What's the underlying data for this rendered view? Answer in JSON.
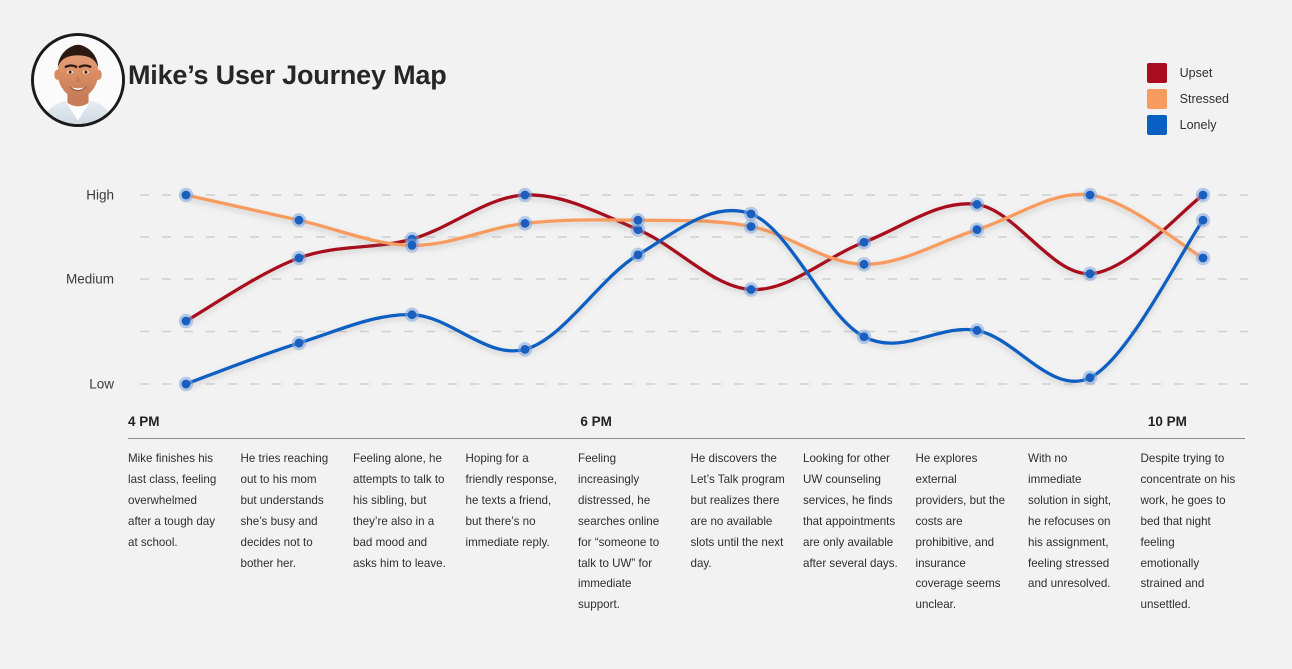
{
  "header": {
    "title": "Mike’s User Journey Map",
    "avatar_alt": "avatar"
  },
  "legend": {
    "items": [
      {
        "label": "Upset",
        "color": "#A80C1E"
      },
      {
        "label": "Stressed",
        "color": "#F89B5F"
      },
      {
        "label": "Lonely",
        "color": "#0A5FC2"
      }
    ]
  },
  "chart_data": {
    "type": "line",
    "title": "Mike’s User Journey Map",
    "xlabel": "",
    "ylabel": "",
    "grid": true,
    "legend_position": "top-right",
    "y_tick_labels": [
      "High",
      "Medium",
      "Low"
    ],
    "y_axis_levels": [
      "Low",
      "Medium",
      "High"
    ],
    "x_tick_labels": [
      "4 PM",
      "6 PM",
      "10 PM"
    ],
    "x_tick_positions": [
      0,
      4,
      9
    ],
    "x": [
      0,
      1,
      2,
      3,
      4,
      5,
      6,
      7,
      8,
      9
    ],
    "series": [
      {
        "name": "Upset",
        "color": "#A80C1E",
        "values": [
          1.0,
          2.0,
          2.3,
          3.0,
          2.45,
          1.5,
          2.25,
          2.85,
          1.75,
          3.0
        ]
      },
      {
        "name": "Stressed",
        "color": "#F89B5F",
        "values": [
          3.0,
          2.6,
          2.2,
          2.55,
          2.6,
          2.5,
          1.9,
          2.45,
          3.0,
          2.0
        ]
      },
      {
        "name": "Lonely",
        "color": "#0A5FC2",
        "values": [
          0.0,
          0.65,
          1.1,
          0.55,
          2.05,
          2.7,
          0.75,
          0.85,
          0.1,
          2.6
        ]
      }
    ]
  },
  "time_axis": {
    "labels": [
      {
        "text": "4 PM",
        "x_pct": 0.0
      },
      {
        "text": "6 PM",
        "x_pct": 40.5
      },
      {
        "text": "10 PM",
        "x_pct": 91.3
      }
    ]
  },
  "stages": [
    {
      "text": "Mike finishes his last class, feeling overwhelmed after a tough day at school."
    },
    {
      "text": "He tries reaching out to his mom but understands she’s busy and decides not to bother her."
    },
    {
      "text": "Feeling alone, he attempts to talk to his sibling, but they’re also in a bad mood and asks him to leave."
    },
    {
      "text": "Hoping for a friendly response, he texts a friend, but there’s no immediate reply."
    },
    {
      "text": "Feeling increasingly distressed, he searches online for “someone to talk to UW” for immediate support."
    },
    {
      "text": "He discovers the Let’s Talk program but realizes there are no available slots until the next day."
    },
    {
      "text": "Looking for other UW counseling services, he finds that appointments are only available after several days."
    },
    {
      "text": "He explores external providers, but the costs are prohibitive, and insurance coverage seems unclear."
    },
    {
      "text": "With no immediate solution in sight, he refocuses on his assignment, feeling stressed and unresolved."
    },
    {
      "text": "Despite trying to concentrate on his work, he goes to bed that night feeling emotionally strained and unsettled."
    }
  ],
  "theme": {
    "background": "#f2f2f2",
    "text": "#2e2e2e",
    "gridline": "#cfcfcf",
    "divider": "#8d8d8d",
    "marker_fill": "#1A5FBF",
    "marker_halo": "#7FA8DC"
  }
}
